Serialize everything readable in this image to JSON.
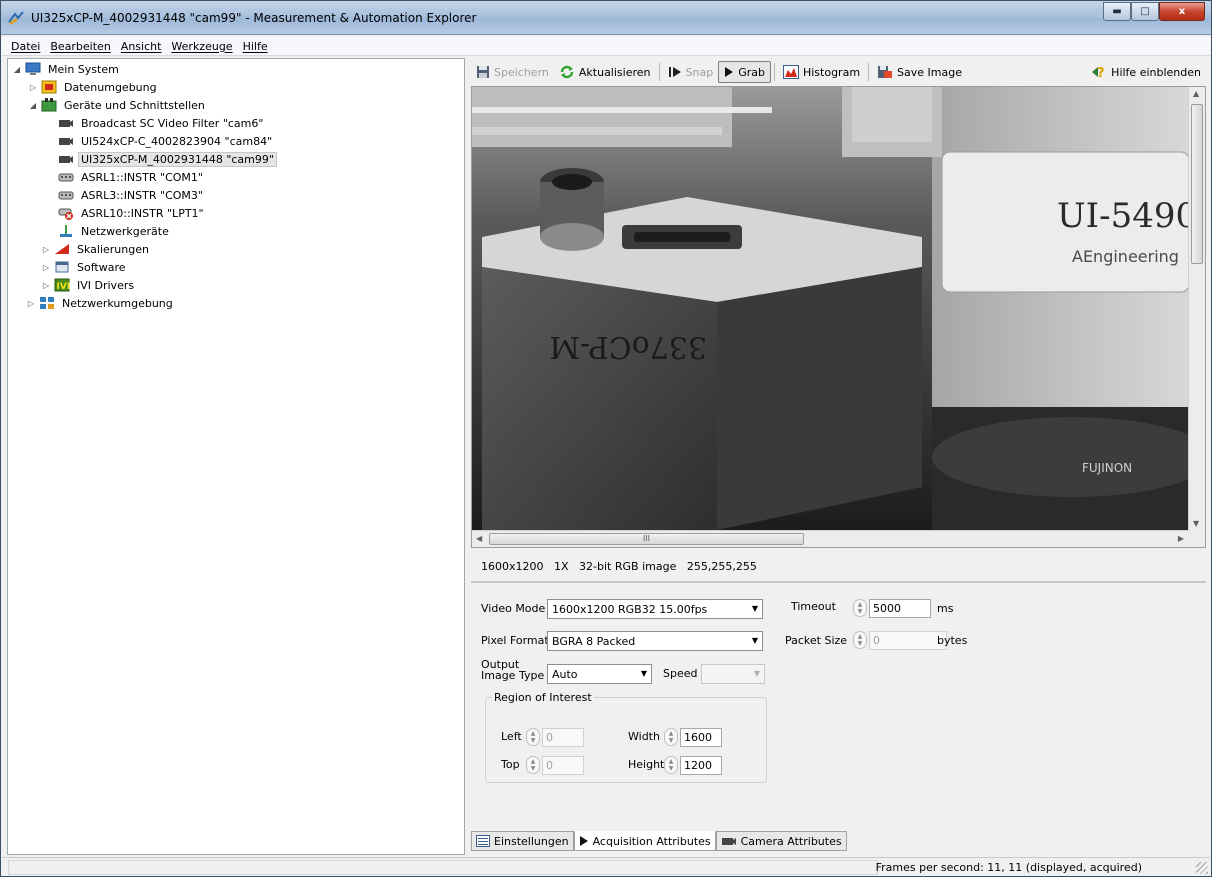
{
  "window": {
    "title": "UI325xCP-M_4002931448 \"cam99\" - Measurement & Automation Explorer",
    "minimize_icon": "minimize-icon",
    "maximize_icon": "maximize-icon",
    "close_label": "x"
  },
  "menu": [
    "Datei",
    "Bearbeiten",
    "Ansicht",
    "Werkzeuge",
    "Hilfe"
  ],
  "tree": {
    "root": "Mein System",
    "datenumgebung": "Datenumgebung",
    "geraete": "Geräte und Schnittstellen",
    "devices": [
      "Broadcast SC Video Filter  \"cam6\"",
      "UI524xCP-C_4002823904  \"cam84\"",
      "UI325xCP-M_4002931448  \"cam99\"",
      "ASRL1::INSTR \"COM1\"",
      "ASRL3::INSTR \"COM3\"",
      "ASRL10::INSTR \"LPT1\"",
      "Netzwerkgeräte"
    ],
    "skalierungen": "Skalierungen",
    "software": "Software",
    "ivi": "IVI Drivers",
    "netzwerkumgebung": "Netzwerkumgebung"
  },
  "toolbar": {
    "save": "Speichern",
    "refresh": "Aktualisieren",
    "snap": "Snap",
    "grab": "Grab",
    "histogram": "Histogram",
    "save_image": "Save Image",
    "help": "Hilfe einblenden"
  },
  "image_info": {
    "resolution": "1600x1200",
    "zoom": "1X",
    "type": "32-bit RGB image",
    "pixel": "255,255,255"
  },
  "image_text": {
    "label_right": "UI-5490",
    "label_right2": "AEngineering",
    "label_block": "337oCP-M",
    "lens": "FUJINON"
  },
  "settings": {
    "video_mode_label": "Video Mode",
    "video_mode_value": "1600x1200 RGB32 15.00fps",
    "pixel_format_label": "Pixel Format",
    "pixel_format_value": "BGRA 8 Packed",
    "output_type_label": "Output\nImage Type",
    "output_type_value": "Auto",
    "speed_label": "Speed",
    "speed_value": "",
    "timeout_label": "Timeout",
    "timeout_value": "5000",
    "timeout_unit": "ms",
    "packet_label": "Packet Size",
    "packet_value": "0",
    "packet_unit": "bytes",
    "roi_title": "Region of Interest",
    "left_label": "Left",
    "left_value": "0",
    "top_label": "Top",
    "top_value": "0",
    "width_label": "Width",
    "width_value": "1600",
    "height_label": "Height",
    "height_value": "1200"
  },
  "tabs": [
    "Einstellungen",
    "Acquisition Attributes",
    "Camera Attributes"
  ],
  "status": "Frames per second: 11, 11 (displayed, acquired)",
  "scroll_thumb_grip": "III"
}
